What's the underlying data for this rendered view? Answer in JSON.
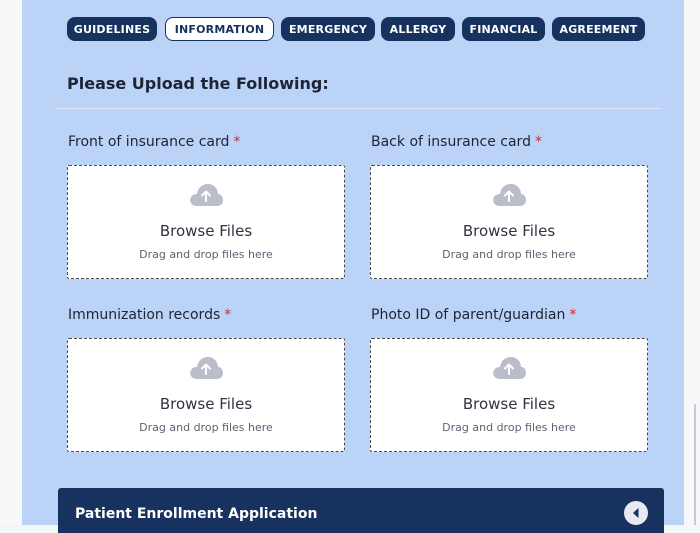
{
  "tabs": [
    {
      "label": "GUIDELINES",
      "active": false
    },
    {
      "label": "INFORMATION",
      "active": true
    },
    {
      "label": "EMERGENCY",
      "active": false
    },
    {
      "label": "ALLERGY",
      "active": false
    },
    {
      "label": "FINANCIAL",
      "active": false
    },
    {
      "label": "AGREEMENT",
      "active": false
    }
  ],
  "section": {
    "heading": "Please Upload the Following:"
  },
  "uploads": [
    {
      "label": "Front of insurance card",
      "required_mark": "*",
      "browse_label": "Browse Files",
      "hint": "Drag and drop files here"
    },
    {
      "label": "Back of insurance card",
      "required_mark": "*",
      "browse_label": "Browse Files",
      "hint": "Drag and drop files here"
    },
    {
      "label": "Immunization records",
      "required_mark": "*",
      "browse_label": "Browse Files",
      "hint": "Drag and drop files here"
    },
    {
      "label": "Photo ID of parent/guardian",
      "required_mark": "*",
      "browse_label": "Browse Files",
      "hint": "Drag and drop files here"
    }
  ],
  "footer": {
    "title": "Patient Enrollment Application",
    "collapse_icon": "chevron-left-icon"
  },
  "colors": {
    "panel": "#bcd3f8",
    "tab": "#17325e",
    "required": "#d62828",
    "footer": "#17325e"
  }
}
